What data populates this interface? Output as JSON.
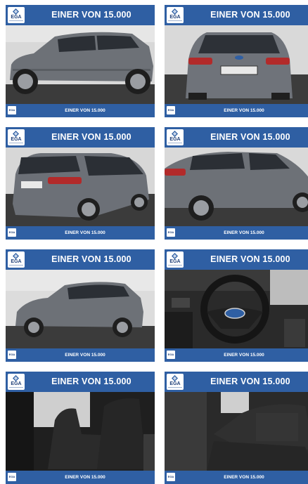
{
  "cards": [
    {
      "banner_title": "EINER VON 15.000",
      "footer_text": "EINER VON 15.000",
      "logo_text": "EGA",
      "photo": "car-side-left"
    },
    {
      "banner_title": "EINER VON 15.000",
      "footer_text": "EINER VON 15.000",
      "logo_text": "EGA",
      "photo": "car-rear"
    },
    {
      "banner_title": "EINER VON 15.000",
      "footer_text": "EINER VON 15.000",
      "logo_text": "EGA",
      "photo": "car-rear-three-quarter"
    },
    {
      "banner_title": "EINER VON 15.000",
      "footer_text": "EINER VON 15.000",
      "logo_text": "EGA",
      "photo": "car-side-right"
    },
    {
      "banner_title": "EINER VON 15.000",
      "footer_text": "EINER VON 15.000",
      "logo_text": "EGA",
      "photo": "car-side-left-far"
    },
    {
      "banner_title": "EINER VON 15.000",
      "footer_text": "EINER VON 15.000",
      "logo_text": "EGA",
      "photo": "steering-wheel-interior"
    },
    {
      "banner_title": "EINER VON 15.000",
      "footer_text": "EINER VON 15.000",
      "logo_text": "EGA",
      "photo": "front-seats-interior"
    },
    {
      "banner_title": "EINER VON 15.000",
      "footer_text": "EINER VON 15.000",
      "logo_text": "EGA",
      "photo": "rear-seats-interior"
    }
  ],
  "colors": {
    "banner": "#2f5fa3",
    "car_body": "#6d7177",
    "background_wall": "#d9d9d9",
    "ground": "#3a3a3a"
  }
}
